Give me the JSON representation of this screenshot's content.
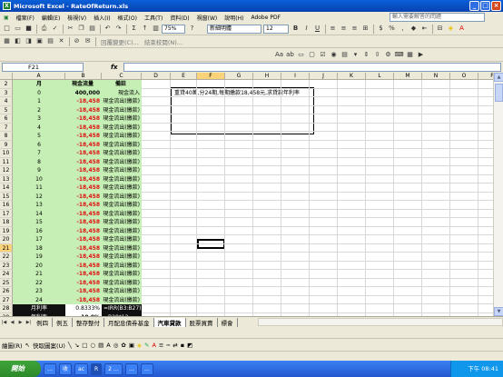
{
  "window": {
    "title": "Microsoft Excel - RateOfReturn.xls"
  },
  "menu": [
    "檔案(F)",
    "編輯(E)",
    "檢視(V)",
    "插入(I)",
    "格式(O)",
    "工具(T)",
    "資料(D)",
    "視窗(W)",
    "說明(H)",
    "Adobe PDF"
  ],
  "help_placeholder": "輸入需要解答的問題",
  "toolbar": {
    "zoom": "75%",
    "font": "新細明體",
    "size": "12",
    "review_label": "回覆變更(C)...",
    "end_review_label": "結束校閱(N)..."
  },
  "formula_bar": {
    "name_box": "F21",
    "fx": "fx",
    "content": ""
  },
  "columns": [
    "A",
    "B",
    "C",
    "D",
    "E",
    "F",
    "G",
    "H",
    "I",
    "J",
    "K",
    "L",
    "M",
    "N",
    "O",
    "P"
  ],
  "row_numbers": [
    "2",
    "3",
    "4",
    "5",
    "6",
    "7",
    "8",
    "9",
    "10",
    "11",
    "12",
    "13",
    "14",
    "15",
    "16",
    "17",
    "18",
    "19",
    "20",
    "21",
    "22",
    "23",
    "24",
    "25",
    "26",
    "27",
    "28",
    "29"
  ],
  "header_row": {
    "a": "月",
    "b": "現金流量",
    "c": "備註"
  },
  "data_rows": [
    {
      "a": "0",
      "b": "400,000",
      "c": "現金流入"
    },
    {
      "a": "1",
      "b": "-18,458",
      "c": "現金流出(繳款)"
    },
    {
      "a": "2",
      "b": "-18,458",
      "c": "現金流出(繳款)"
    },
    {
      "a": "3",
      "b": "-18,458",
      "c": "現金流出(繳款)"
    },
    {
      "a": "4",
      "b": "-18,458",
      "c": "現金流出(繳款)"
    },
    {
      "a": "5",
      "b": "-18,458",
      "c": "現金流出(繳款)"
    },
    {
      "a": "6",
      "b": "-18,458",
      "c": "現金流出(繳款)"
    },
    {
      "a": "7",
      "b": "-18,458",
      "c": "現金流出(繳款)"
    },
    {
      "a": "8",
      "b": "-18,458",
      "c": "現金流出(繳款)"
    },
    {
      "a": "9",
      "b": "-18,458",
      "c": "現金流出(繳款)"
    },
    {
      "a": "10",
      "b": "-18,458",
      "c": "現金流出(繳款)"
    },
    {
      "a": "11",
      "b": "-18,458",
      "c": "現金流出(繳款)"
    },
    {
      "a": "12",
      "b": "-18,458",
      "c": "現金流出(繳款)"
    },
    {
      "a": "13",
      "b": "-18,458",
      "c": "現金流出(繳款)"
    },
    {
      "a": "14",
      "b": "-18,458",
      "c": "現金流出(繳款)"
    },
    {
      "a": "15",
      "b": "-18,458",
      "c": "現金流出(繳款)"
    },
    {
      "a": "16",
      "b": "-18,458",
      "c": "現金流出(繳款)"
    },
    {
      "a": "17",
      "b": "-18,458",
      "c": "現金流出(繳款)"
    },
    {
      "a": "18",
      "b": "-18,458",
      "c": "現金流出(繳款)"
    },
    {
      "a": "19",
      "b": "-18,458",
      "c": "現金流出(繳款)"
    },
    {
      "a": "20",
      "b": "-18,458",
      "c": "現金流出(繳款)"
    },
    {
      "a": "21",
      "b": "-18,458",
      "c": "現金流出(繳款)"
    },
    {
      "a": "22",
      "b": "-18,458",
      "c": "現金流出(繳款)"
    },
    {
      "a": "23",
      "b": "-18,458",
      "c": "現金流出(繳款)"
    },
    {
      "a": "24",
      "b": "-18,458",
      "c": "現金流出(繳款)"
    }
  ],
  "summary_rows": [
    {
      "a": "月利率",
      "b": "0.8333%",
      "c": "=IRR(B3:B27)"
    },
    {
      "a": "年利率",
      "b": "10.0%",
      "c": "=B28*12"
    }
  ],
  "note": "重貸40萬,分24期,每期繳款18,458元,求貸款年利率",
  "sheet_tabs": [
    "例四",
    "例五",
    "整存整付",
    "月配息債券基金",
    "汽車貸款",
    "股票買賣",
    "標會"
  ],
  "active_tab": "汽車貸款",
  "drawing_toolbar": {
    "draw_label": "繪圖(R)",
    "autoshape_label": "快取圖案(U)"
  },
  "taskbar": {
    "start_label": "開始",
    "tasks": [
      "…",
      "收",
      "ac",
      "R",
      "2 …",
      "…",
      "…"
    ],
    "clock": "下午 08:41"
  }
}
